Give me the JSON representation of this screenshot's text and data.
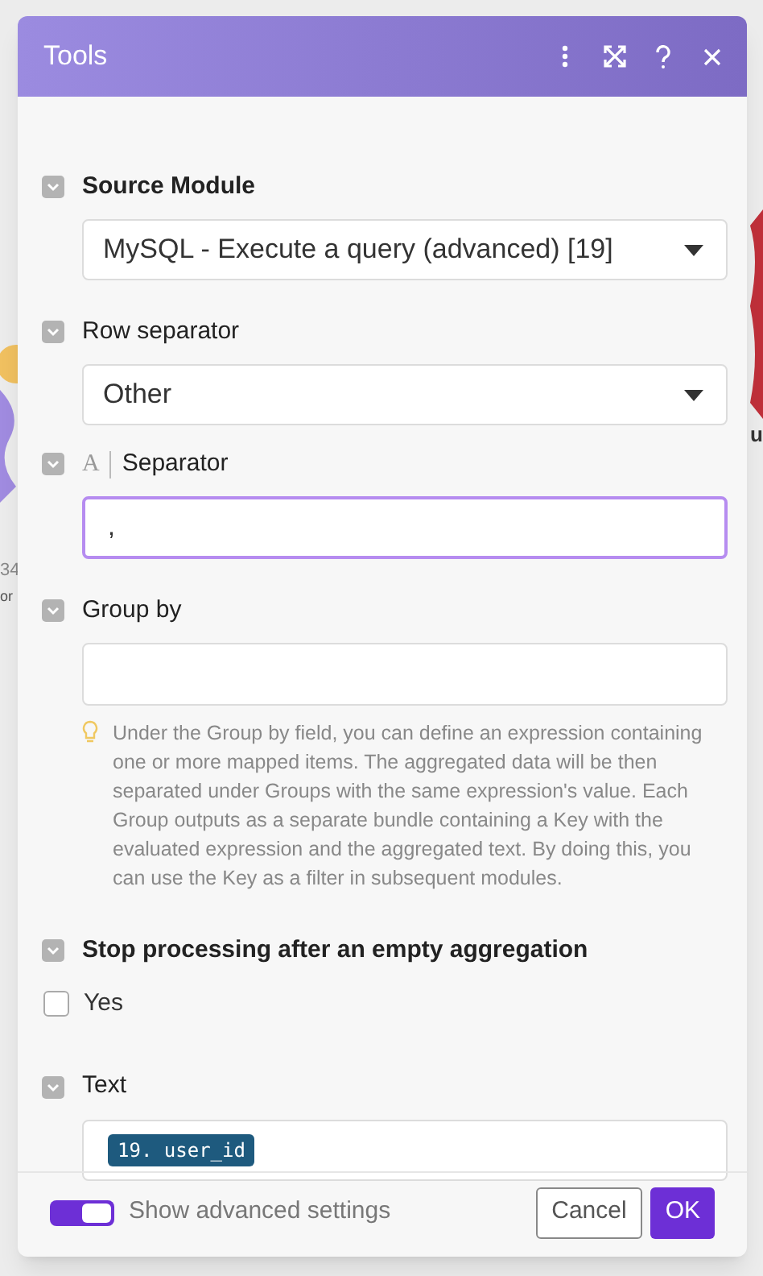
{
  "background": {
    "texts": [
      "34",
      "or",
      "u"
    ]
  },
  "dialog": {
    "title": "Tools"
  },
  "fields": [
    {
      "kind": "select",
      "label": "Source Module",
      "bold": true,
      "value": "MySQL - Execute a query (advanced) [19]"
    },
    {
      "kind": "select",
      "label": "Row separator",
      "bold": false,
      "value": "Other"
    },
    {
      "kind": "text",
      "label": "Separator",
      "bold": false,
      "type_glyph": "A",
      "value": ",",
      "focused": true
    },
    {
      "kind": "text",
      "label": "Group by",
      "bold": false,
      "focused": false,
      "hint": "Under the Group by field, you can define an expression containing one or more mapped items. The aggregated data will be then separated under Groups with the same expression's value. Each Group outputs as a separate bundle containing a Key with the evaluated expression and the aggregated text. By doing this, you can use the Key as a filter in subsequent modules."
    },
    {
      "kind": "checkbox",
      "label": "Stop processing after an empty aggregation",
      "bold": true,
      "option": "Yes",
      "checked": false
    },
    {
      "kind": "token",
      "label": "Text",
      "bold": false,
      "token": "19. user_id"
    }
  ],
  "footer": {
    "toggle": {
      "label": "Show advanced settings",
      "on": true
    },
    "buttons": [
      "Cancel",
      "OK"
    ]
  }
}
